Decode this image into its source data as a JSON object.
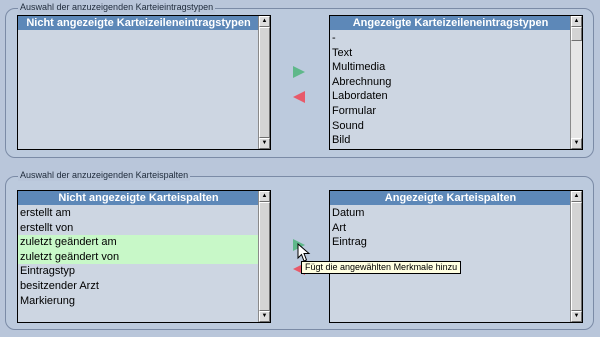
{
  "entry_types_section": {
    "title": "Auswahl der anzuzeigenden Karteieintragstypen",
    "hidden_list": {
      "header": "Nicht angezeigte Karteizeileneintragstypen",
      "items": []
    },
    "shown_list": {
      "header": "Angezeigte Karteizeileneintragstypen",
      "items": [
        "-",
        "Text",
        "Multimedia",
        "Abrechnung",
        "Labordaten",
        "Formular",
        "Sound",
        "Bild"
      ]
    }
  },
  "columns_section": {
    "title": "Auswahl der anzuzeigenden Karteispalten",
    "hidden_list": {
      "header": "Nicht angezeigte Karteispalten",
      "items": [
        "erstellt am",
        "erstellt von",
        "zuletzt geändert am",
        "zuletzt geändert von",
        "Eintragstyp",
        "besitzender Arzt",
        "Markierung"
      ],
      "selected": [
        2,
        3
      ]
    },
    "shown_list": {
      "header": "Angezeigte Karteispalten",
      "items": [
        "Datum",
        "Art",
        "Eintrag"
      ]
    }
  },
  "tooltip": {
    "text": "Fügt die angewählten Merkmale hinzu"
  },
  "colors": {
    "header_bg": "#5d88b8",
    "selection_bg": "#c8f8c8",
    "add_arrow": "#5fb88a",
    "remove_arrow": "#e85a6a"
  },
  "icons": {
    "add": "triangle-right-icon",
    "remove": "triangle-left-icon",
    "scroll_up": "chevron-up-icon",
    "scroll_down": "chevron-down-icon",
    "cursor": "mouse-pointer-icon"
  }
}
